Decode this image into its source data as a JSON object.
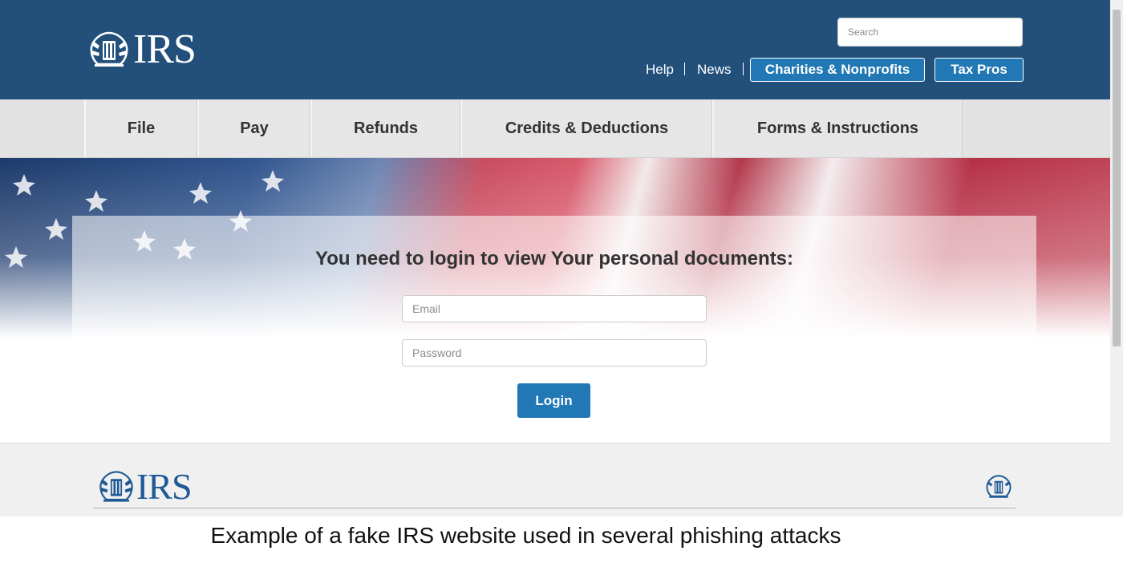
{
  "colors": {
    "header_bg": "#22507b",
    "accent_button": "#2178b4",
    "nav_bg": "#e6e6e6",
    "footer_bg": "#f0f0f0",
    "footer_logo": "#1f5a96"
  },
  "header": {
    "logo_text": "IRS",
    "logo_icon": "eagle-seal-icon",
    "search_placeholder": "Search",
    "links": {
      "help": "Help",
      "news": "News"
    },
    "buttons": {
      "charities": "Charities & Nonprofits",
      "tax_pros": "Tax Pros"
    }
  },
  "nav": {
    "items": [
      "File",
      "Pay",
      "Refunds",
      "Credits & Deductions",
      "Forms & Instructions"
    ]
  },
  "hero": {
    "background": "american-flag",
    "title": "You need to login to view Your personal documents:"
  },
  "login_form": {
    "email_placeholder": "Email",
    "password_placeholder": "Password",
    "submit_label": "Login"
  },
  "footer": {
    "logo_text": "IRS",
    "logo_icon": "eagle-seal-icon"
  },
  "caption": "Example of a fake IRS website used in several phishing attacks"
}
